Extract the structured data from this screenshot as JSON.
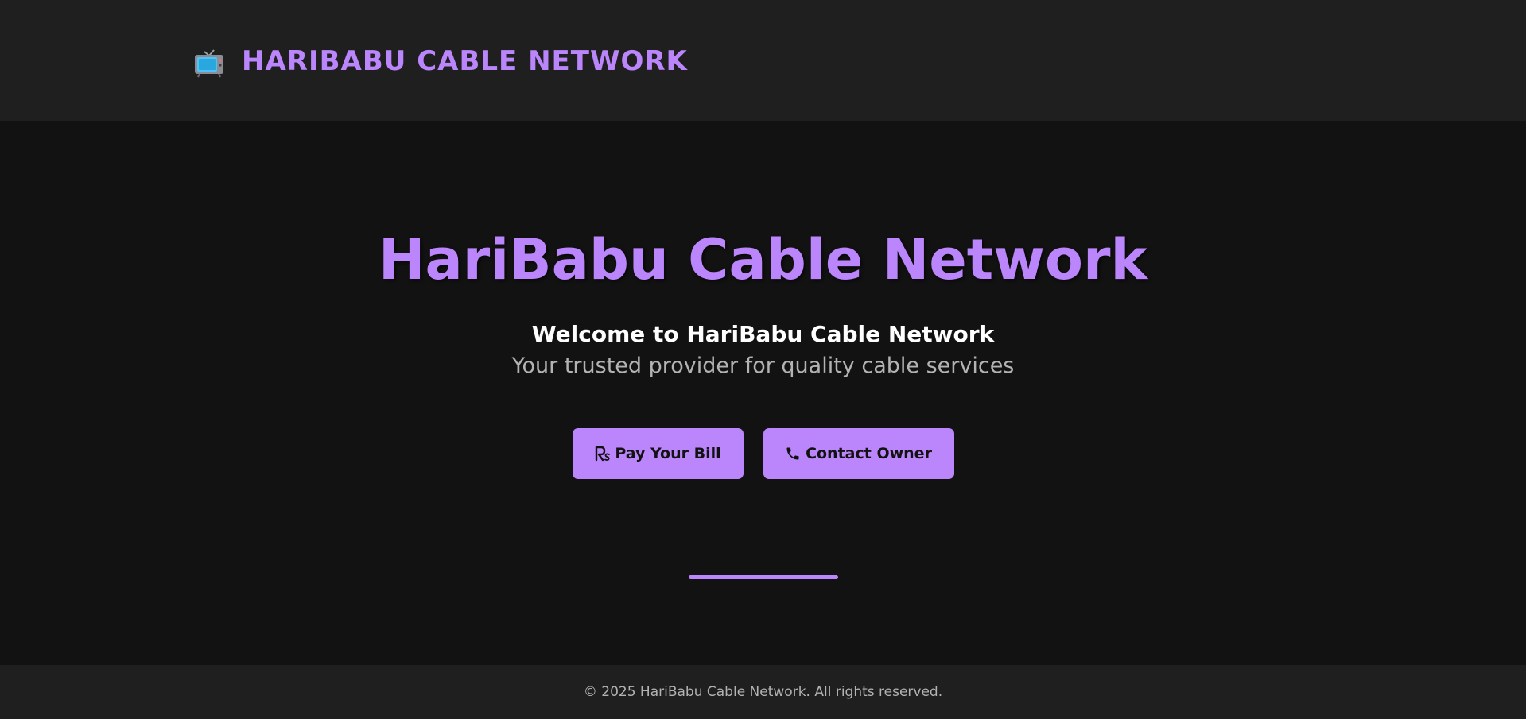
{
  "header": {
    "brand_icon": "tv-icon",
    "brand_text": "HARIBABU CABLE NETWORK"
  },
  "hero": {
    "title": "HariBabu Cable Network",
    "welcome": "Welcome to HariBabu Cable Network",
    "tagline": "Your trusted provider for quality cable services"
  },
  "actions": {
    "pay_icon": "rupee-icon",
    "pay_label": "Pay Your Bill",
    "contact_icon": "phone-icon",
    "contact_label": "Contact Owner"
  },
  "footer": {
    "copyright": "© 2025 HariBabu Cable Network. All rights reserved."
  },
  "colors": {
    "accent": "#bb86fc",
    "background": "#121212",
    "surface": "#1f1f1f",
    "text_primary": "#ffffff",
    "text_secondary": "#b3b3b3"
  }
}
